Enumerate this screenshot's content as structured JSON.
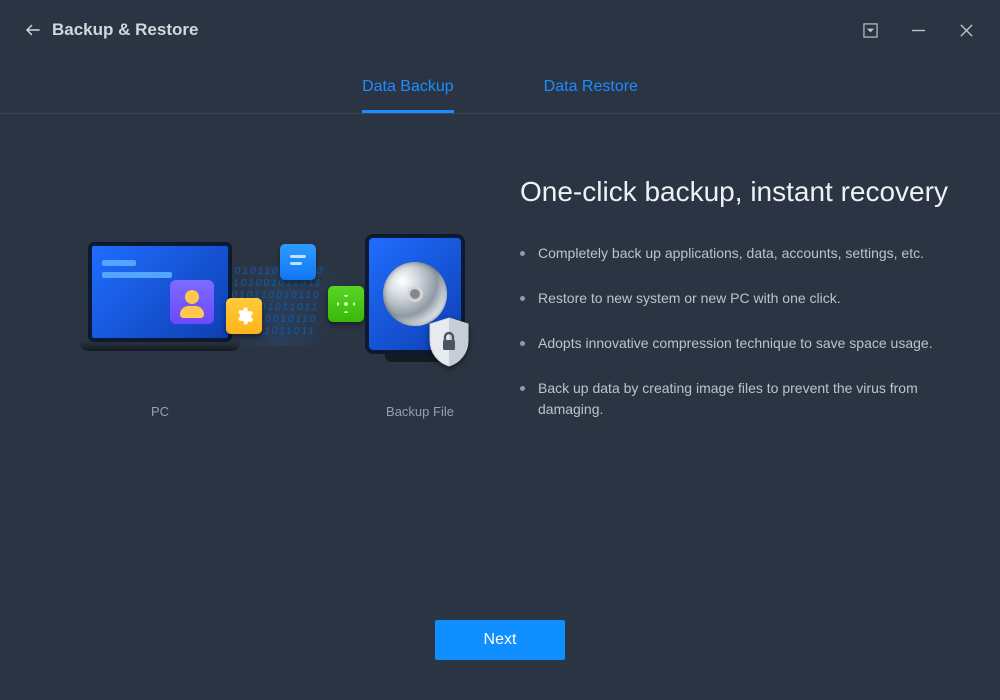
{
  "window": {
    "title": "Backup & Restore"
  },
  "tabs": {
    "backup": "Data Backup",
    "restore": "Data Restore"
  },
  "illustration": {
    "left_label": "PC",
    "right_label": "Backup File"
  },
  "info": {
    "headline": "One-click backup, instant recovery",
    "bullets": [
      "Completely back up applications, data, accounts, settings, etc.",
      "Restore to new system or new PC with one click.",
      "Adopts innovative compression technique to save space usage.",
      "Back up data by creating image files to prevent the virus from damaging."
    ]
  },
  "footer": {
    "next_label": "Next"
  }
}
